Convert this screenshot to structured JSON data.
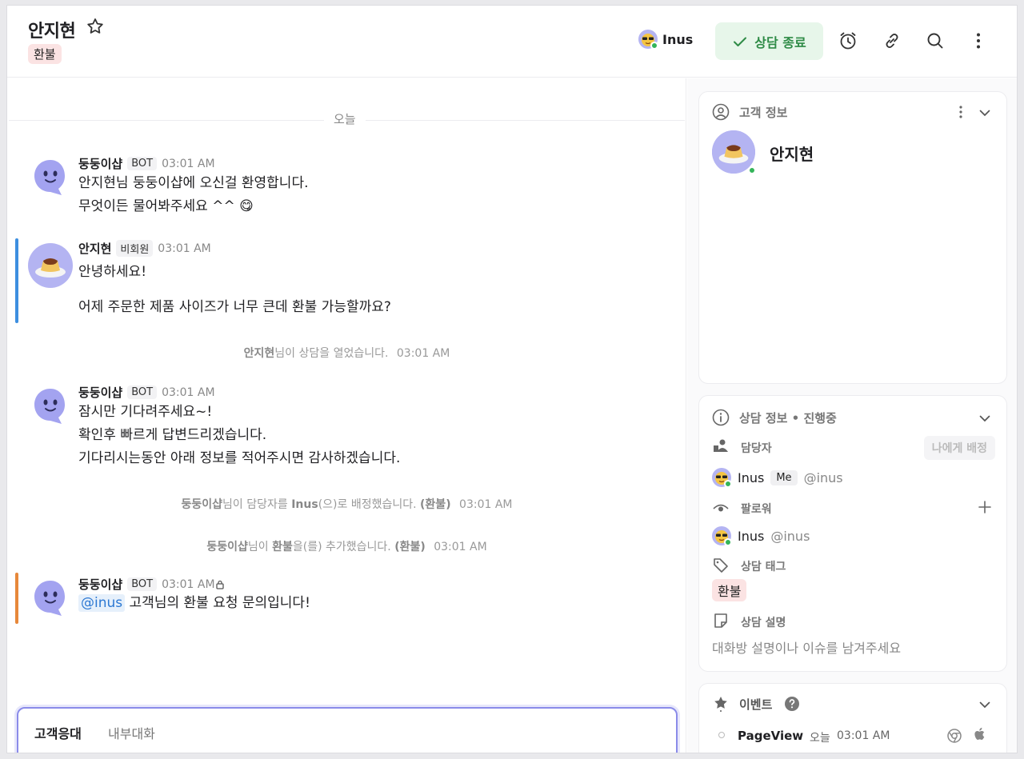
{
  "header": {
    "title": "안지현",
    "tag": "환불",
    "assignee_name": "Inus",
    "end_button_label": "상담 종료"
  },
  "chat": {
    "date_divider": "오늘",
    "messages": [
      {
        "sender": "둥둥이샵",
        "badge": "BOT",
        "time": "03:01 AM",
        "lines": [
          "안지현님 둥둥이샵에 오신걸 환영합니다.",
          "무엇이든 물어봐주세요 ^^ 😋"
        ]
      },
      {
        "sender": "안지현",
        "badge": "비회원",
        "time": "03:01 AM",
        "lines": [
          "안녕하세요!",
          "어제 주문한 제품 사이즈가 너무 큰데 환불 가능할까요?"
        ]
      },
      {
        "sender": "둥둥이샵",
        "badge": "BOT",
        "time": "03:01 AM",
        "lines": [
          "잠시만 기다려주세요~!",
          "확인후 빠르게 답변드리겠습니다.",
          "기다리시는동안 아래 정보를 적어주시면 감사하겠습니다."
        ]
      },
      {
        "sender": "둥둥이샵",
        "badge": "BOT",
        "time": "03:01 AM",
        "mention": "@inus",
        "text": " 고객님의 환불 요청 문의입니다!"
      }
    ],
    "system_events": [
      {
        "actor": "안지현",
        "text": "님이 상담을 열었습니다.",
        "time": "03:01 AM"
      },
      {
        "actor": "둥둥이샵",
        "text1": "님이 담당자를 ",
        "target": "Inus",
        "text2": "(으)로 배정했습니다. ",
        "tag": "(환불)",
        "time": "03:01 AM"
      },
      {
        "actor": "둥둥이샵",
        "text1": "님이 ",
        "target": "환불",
        "text2": "을(를) 추가했습니다. ",
        "tag": "(환불)",
        "time": "03:01 AM"
      }
    ],
    "composer": {
      "tab_customer": "고객응대",
      "tab_internal": "내부대화"
    }
  },
  "side": {
    "customer": {
      "title": "고객 정보",
      "name": "안지현"
    },
    "consult": {
      "title": "상담 정보 • 진행중",
      "assignee_label": "담당자",
      "assign_me_button": "나에게 배정",
      "assignee_name": "Inus",
      "me_badge": "Me",
      "assignee_handle": "@inus",
      "follower_label": "팔로워",
      "follower_name": "Inus",
      "follower_handle": "@inus",
      "tag_label": "상담 태그",
      "tag": "환불",
      "desc_label": "상담 설명",
      "desc_placeholder": "대화방 설명이나 이슈를 남겨주세요"
    },
    "events": {
      "title": "이벤트",
      "event_name": "PageView",
      "event_day": "오늘",
      "event_time": "03:01 AM"
    }
  },
  "colors": {
    "accent": "#8a8be9",
    "success": "#2e8b46",
    "tag_bg": "#fbe3e3",
    "bar_blue": "#3d8fe0",
    "bar_orange": "#e7883a"
  }
}
